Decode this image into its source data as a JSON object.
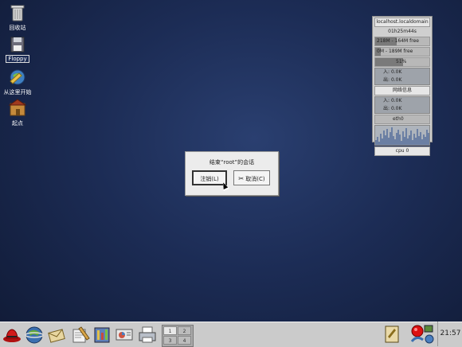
{
  "desktop": {
    "icons": [
      {
        "id": "trash",
        "label": "回收站",
        "icon": "trash-icon"
      },
      {
        "id": "floppy",
        "label": "Floppy",
        "icon": "floppy-icon"
      },
      {
        "id": "start",
        "label": "从这里开始",
        "icon": "start-here-icon"
      },
      {
        "id": "home",
        "label": "起点",
        "icon": "home-icon"
      }
    ]
  },
  "monitor": {
    "hostname": "localhost.localdomain",
    "uptime": "01h25m44s",
    "mem": "218M - 164M free",
    "swap": "0M - 189M free",
    "disk_percent": "51%",
    "disk_fill": 0.51,
    "net_in": "0.0K",
    "net_out": "0.0K",
    "section_label": "网络信息",
    "net2_in": "0.0K",
    "net2_out": "0.0K",
    "eth_label": "eth0",
    "cpu_label": "cpu 0"
  },
  "dialog": {
    "title": "结束“root”的会话",
    "logout_label": "注销(L)",
    "cancel_label": "取消(C)"
  },
  "panel": {
    "clock": "21:57",
    "workspaces": [
      "1",
      "2",
      "3",
      "4"
    ],
    "active_workspace": "1",
    "launchers": [
      {
        "icon": "redhat-menu-icon"
      },
      {
        "icon": "web-browser-icon"
      },
      {
        "icon": "mail-icon"
      },
      {
        "icon": "text-editor-icon"
      },
      {
        "icon": "office-icon"
      },
      {
        "icon": "presentation-icon"
      },
      {
        "icon": "printer-icon"
      }
    ]
  }
}
